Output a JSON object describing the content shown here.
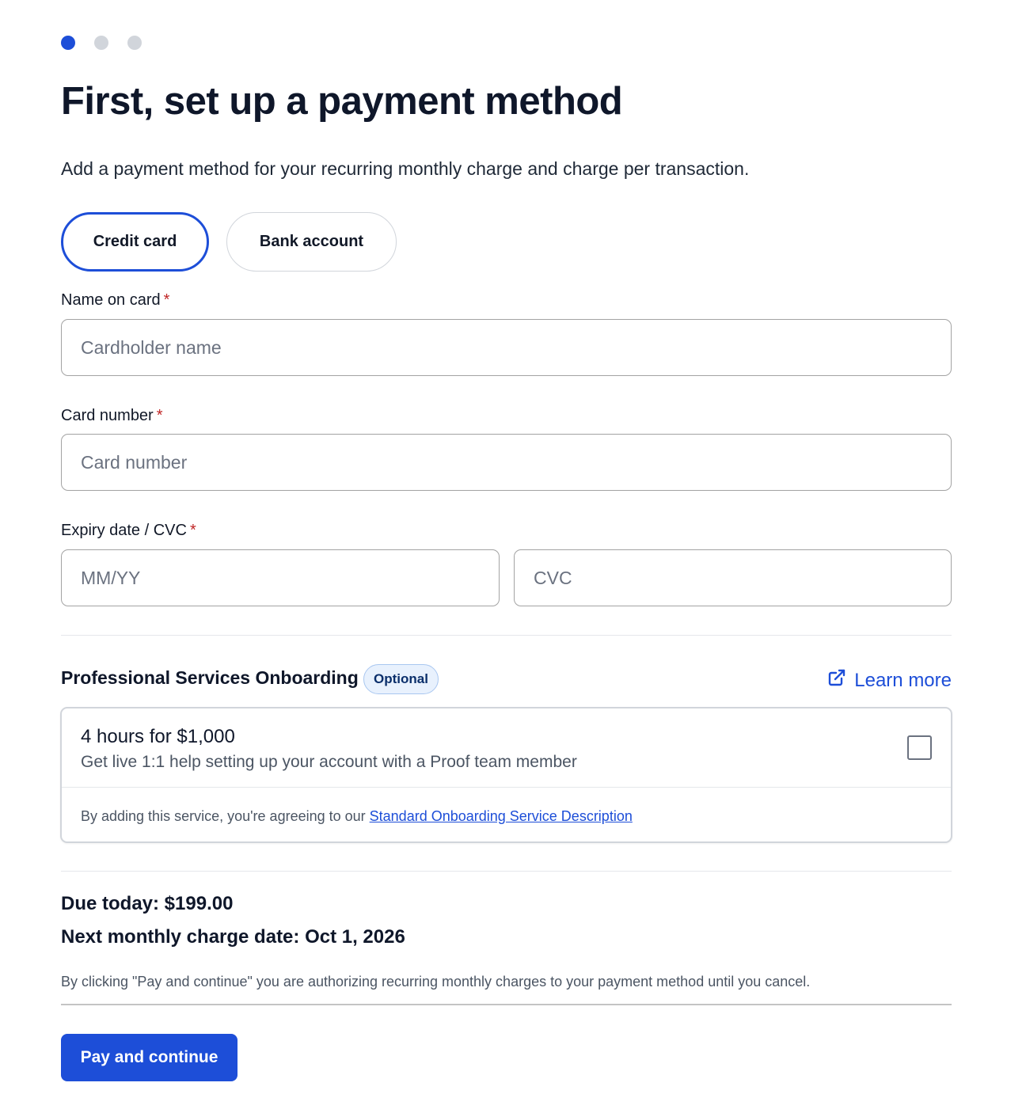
{
  "stepper": {
    "steps": [
      {
        "state": "active",
        "color": "#1d4ed8"
      },
      {
        "state": "inactive",
        "color": "#d1d5db"
      },
      {
        "state": "inactive",
        "color": "#d1d5db"
      }
    ]
  },
  "header": {
    "title": "First, set up a payment method",
    "subtitle": "Add a payment method for your recurring monthly charge and charge per transaction."
  },
  "payment_method": {
    "selected": "Credit card",
    "options": [
      "Credit card",
      "Bank account"
    ]
  },
  "form": {
    "name_label": "Name on card",
    "name_placeholder": "Cardholder name",
    "name_value": "",
    "card_label": "Card number",
    "card_placeholder": "Card number",
    "card_value": "",
    "expiry_label": "Expiry date / CVC",
    "expiry_placeholder": "MM/YY",
    "expiry_value": "",
    "cvc_placeholder": "CVC",
    "cvc_value": "",
    "required_marker": "*"
  },
  "onboarding": {
    "title": "Professional Services Onboarding",
    "badge": "Optional",
    "learn_more": "Learn more",
    "learn_more_icon": "external-link-icon",
    "price": "4 hours for $1,000",
    "description": "Get live 1:1 help setting up your account with a Proof team member",
    "checked": false,
    "terms_prefix": "By adding this service, you're agreeing to our",
    "terms_link": "Standard Onboarding Service Description"
  },
  "summary": {
    "due_today": "Due today: $199.00",
    "next_charge": "Next monthly charge date: Oct 1, 2026",
    "authorization_note": "By clicking \"Pay and continue\" you are authorizing recurring monthly charges to your payment method until you cancel."
  },
  "actions": {
    "pay_label": "Pay and continue"
  },
  "colors": {
    "accent": "#1d4ed8",
    "required": "#c02626",
    "badge_bg": "#e8f1fd"
  }
}
